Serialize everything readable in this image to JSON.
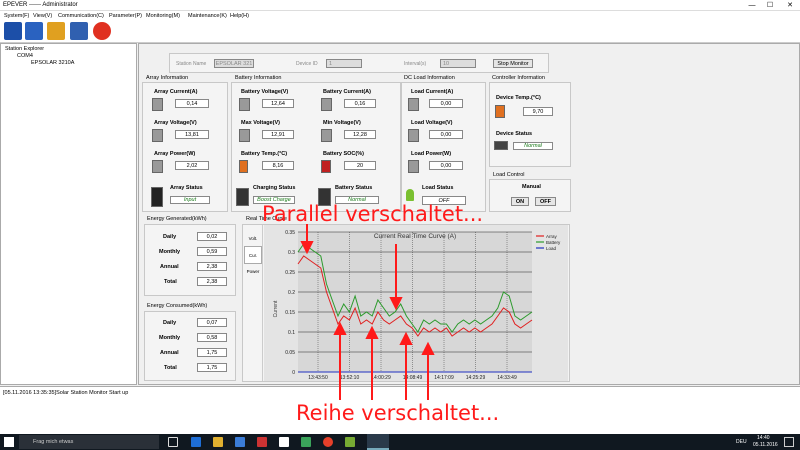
{
  "window": {
    "title": "EPEVER ------ Administrator",
    "min": "—",
    "max": "☐",
    "close": "✕"
  },
  "menu": [
    "System(F)",
    "View(V)",
    "Communication(C)",
    "Parameter(P)",
    "Monitoring(M)",
    "Maintenance(K)",
    "Help(H)"
  ],
  "explorer": {
    "root": "Station Explorer",
    "port": "COM4",
    "device": "EPSOLAR 3210A"
  },
  "header": {
    "station_name_label": "Station Name",
    "station_name": "EPSOLAR 321",
    "device_id_label": "Device ID",
    "device_id": "1",
    "interval_label": "Interval(s)",
    "interval": "10",
    "stop_button": "Stop Monitor"
  },
  "array": {
    "title": "Array Information",
    "current_label": "Array Current(A)",
    "current": "0,14",
    "voltage_label": "Array Voltage(V)",
    "voltage": "13,81",
    "power_label": "Array Power(W)",
    "power": "2,02",
    "status_label": "Array Status",
    "status": "Input"
  },
  "battery": {
    "title": "Battery Information",
    "voltage_label": "Battery Voltage(V)",
    "voltage": "12,64",
    "current_label": "Battery Current(A)",
    "current": "0,16",
    "max_label": "Max Voltage(V)",
    "max": "12,91",
    "min_label": "Min Voltage(V)",
    "min": "12,28",
    "temp_label": "Battery Temp.(°C)",
    "temp": "8,16",
    "soc_label": "Battery SOC(%)",
    "soc": "20",
    "charging_label": "Charging Status",
    "charging": "Boost Charge",
    "status_label": "Battery Status",
    "status": "Normal"
  },
  "load": {
    "title": "DC Load Information",
    "current_label": "Load Current(A)",
    "current": "0,00",
    "voltage_label": "Load Voltage(V)",
    "voltage": "0,00",
    "power_label": "Load Power(W)",
    "power": "0,00",
    "status_label": "Load Status",
    "status": "OFF"
  },
  "controller": {
    "title": "Controller Information",
    "temp_label": "Device Temp.(°C)",
    "temp": "9,70",
    "status_label": "Device Status",
    "status": "Normal"
  },
  "load_control": {
    "title": "Load Control",
    "mode": "Manual",
    "on": "ON",
    "off": "OFF"
  },
  "energy_generated": {
    "title": "Energy Generated(kWh)",
    "daily_label": "Daily",
    "daily": "0,02",
    "monthly_label": "Monthly",
    "monthly": "0,59",
    "annual_label": "Annual",
    "annual": "2,38",
    "total_label": "Total",
    "total": "2,38"
  },
  "energy_consumed": {
    "title": "Energy Consumed(kWh)",
    "daily_label": "Daily",
    "daily": "0,07",
    "monthly_label": "Monthly",
    "monthly": "0,58",
    "annual_label": "Annual",
    "annual": "1,75",
    "total_label": "Total",
    "total": "1,75"
  },
  "curve": {
    "title": "Real Time Curve",
    "tabs": [
      "Volt.",
      "Cur.",
      "Power"
    ]
  },
  "status_log": "[05.11.2016 13:35:35]Solar Station Monitor Start up",
  "annotations": {
    "top": "Parallel verschaltet...",
    "bottom": "Reihe verschaltet..."
  },
  "colors": {
    "battery": "#2c9a2c",
    "array": "#e02020",
    "load": "#2030c0",
    "annotation": "#ff1a1a"
  },
  "taskbar": {
    "search": "Frag mich etwas",
    "lang": "DEU",
    "time": "14:40",
    "date": "05.11.2016"
  },
  "chart_data": {
    "type": "line",
    "title": "Current Real Time Curve (A)",
    "ylabel": "Current",
    "xlabel": "",
    "ylim": [
      0,
      0.35
    ],
    "yticks": [
      "0.35",
      "0.3",
      "0.25",
      "0.2",
      "0.15",
      "0.1",
      "0.05",
      "0"
    ],
    "xticks": [
      "13:43:50",
      "13:52:10",
      "14:00:29",
      "14:08:49",
      "14:17:09",
      "14:25:29",
      "14:33:49"
    ],
    "legend": [
      "Array",
      "Battery",
      "Load"
    ],
    "legend_position": "right",
    "grid": true,
    "series": [
      {
        "name": "Array",
        "values": [
          0.27,
          0.29,
          0.28,
          0.27,
          0.26,
          0.2,
          0.16,
          0.12,
          0.14,
          0.13,
          0.16,
          0.12,
          0.13,
          0.12,
          0.15,
          0.13,
          0.12,
          0.13,
          0.14,
          0.12,
          0.11,
          0.09,
          0.11,
          0.1,
          0.11,
          0.1,
          0.11,
          0.09,
          0.1,
          0.11,
          0.1,
          0.11,
          0.1,
          0.11,
          0.12,
          0.14,
          0.16,
          0.15,
          0.12,
          0.11,
          0.12,
          0.13
        ]
      },
      {
        "name": "Battery",
        "values": [
          0.3,
          0.32,
          0.31,
          0.3,
          0.29,
          0.22,
          0.18,
          0.14,
          0.17,
          0.15,
          0.19,
          0.14,
          0.15,
          0.14,
          0.18,
          0.16,
          0.14,
          0.15,
          0.17,
          0.14,
          0.12,
          0.1,
          0.13,
          0.12,
          0.13,
          0.12,
          0.12,
          0.1,
          0.12,
          0.13,
          0.12,
          0.13,
          0.12,
          0.13,
          0.14,
          0.16,
          0.2,
          0.19,
          0.14,
          0.13,
          0.14,
          0.15
        ]
      },
      {
        "name": "Load",
        "values": [
          0,
          0,
          0,
          0,
          0,
          0,
          0,
          0,
          0,
          0,
          0,
          0,
          0,
          0,
          0,
          0,
          0,
          0,
          0,
          0,
          0,
          0,
          0,
          0,
          0,
          0,
          0,
          0,
          0,
          0,
          0,
          0,
          0,
          0,
          0,
          0,
          0,
          0,
          0,
          0,
          0,
          0
        ]
      }
    ]
  }
}
